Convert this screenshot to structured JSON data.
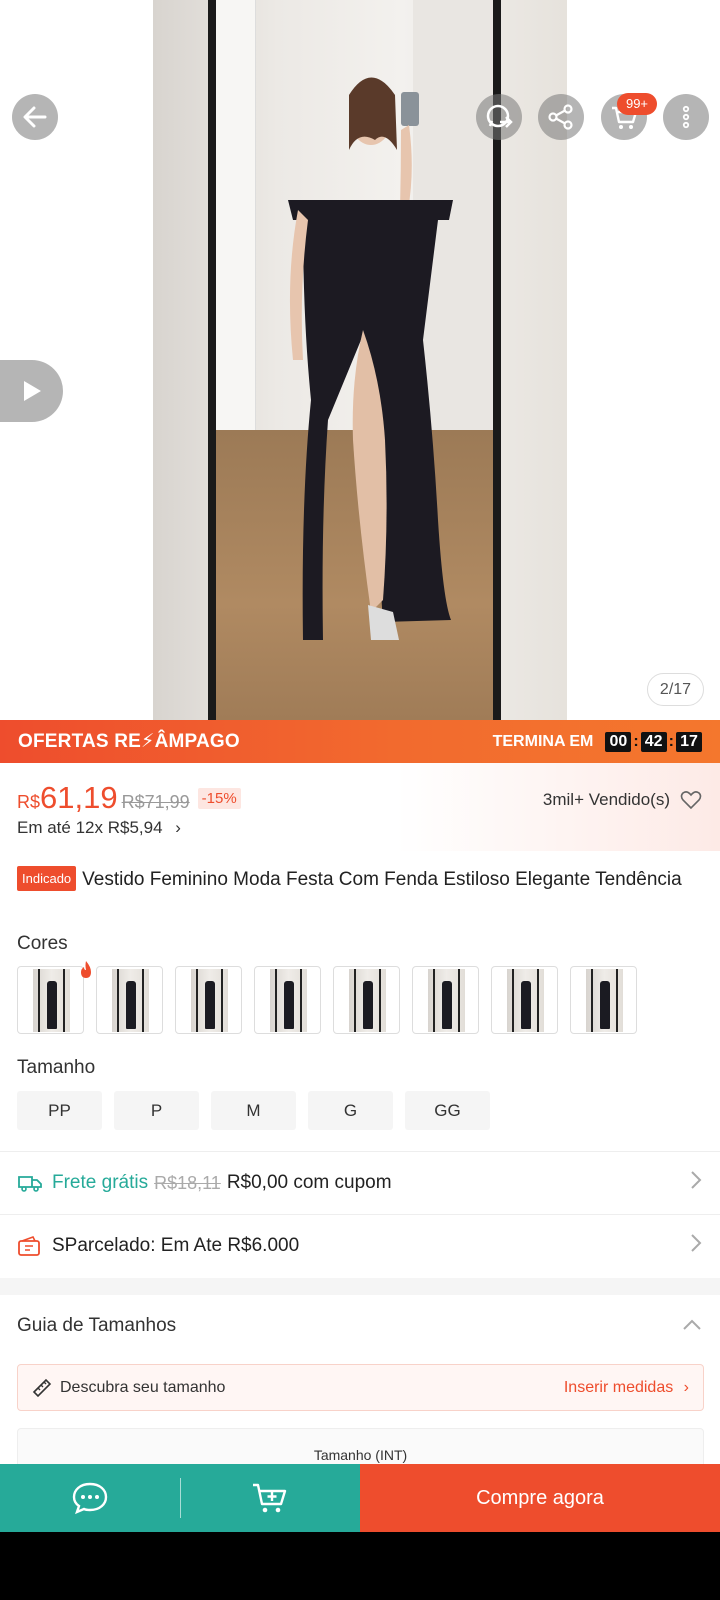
{
  "header": {
    "back_icon": "arrow-left-icon",
    "chat_icon": "whatsapp-icon",
    "share_icon": "share-icon",
    "cart_icon": "cart-icon",
    "cart_badge": "99+",
    "more_icon": "more-vertical-icon"
  },
  "gallery": {
    "counter": "2/17",
    "video_icon": "play-icon"
  },
  "flash_sale": {
    "title": "OFERTAS RE⚡ÂMPAGO",
    "ends_label": "TERMINA EM",
    "hours": "00",
    "minutes": "42",
    "seconds": "17"
  },
  "price": {
    "currency": "R$",
    "current": "61,19",
    "original": "R$71,99",
    "discount": "-15%",
    "installments": "Em até 12x R$5,94",
    "sold": "3mil+ Vendido(s)"
  },
  "product": {
    "badge": "Indicado",
    "title": "Vestido Feminino Moda Festa Com Fenda Estiloso Elegante Tendência"
  },
  "colors": {
    "label": "Cores",
    "count": 8
  },
  "sizes": {
    "label": "Tamanho",
    "options": [
      "PP",
      "P",
      "M",
      "G",
      "GG"
    ]
  },
  "shipping": {
    "free_label": "Frete grátis",
    "old_price": "R$18,11",
    "new_price": "R$0,00 com cupom"
  },
  "installment_row": {
    "label": "SParcelado: Em Ate R$6.000"
  },
  "size_guide": {
    "title": "Guia de Tamanhos",
    "discover": "Descubra seu tamanho",
    "insert": "Inserir medidas",
    "table_header": "Tamanho (INT)"
  },
  "bottom": {
    "chat_icon": "chat-icon",
    "add_cart_icon": "add-to-cart-icon",
    "buy_label": "Compre agora"
  },
  "colors_theme": {
    "accent": "#ee4d2d",
    "green": "#26aa99"
  }
}
